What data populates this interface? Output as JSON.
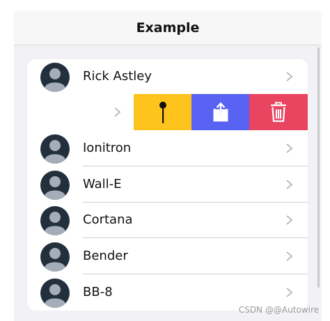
{
  "header": {
    "title": "Example"
  },
  "colors": {
    "pin": "#fec31c",
    "share": "#5862f3",
    "delete": "#ea4560",
    "avatar_bg": "#222f3c",
    "avatar_person": "#a5adb8",
    "chevron": "#b3b3b3"
  },
  "list": {
    "items": [
      {
        "label": "Rick Astley",
        "avatar_icon": "avatar-icon",
        "chevron_icon": "chevron-right-icon"
      },
      {
        "label": "Ionitron",
        "avatar_icon": "avatar-icon",
        "chevron_icon": "chevron-right-icon"
      },
      {
        "label": "Wall-E",
        "avatar_icon": "avatar-icon",
        "chevron_icon": "chevron-right-icon"
      },
      {
        "label": "Cortana",
        "avatar_icon": "avatar-icon",
        "chevron_icon": "chevron-right-icon"
      },
      {
        "label": "Bender",
        "avatar_icon": "avatar-icon",
        "chevron_icon": "chevron-right-icon"
      },
      {
        "label": "BB-8",
        "avatar_icon": "avatar-icon",
        "chevron_icon": "chevron-right-icon"
      }
    ],
    "sliding_options": [
      {
        "name": "pin",
        "icon": "pin-icon"
      },
      {
        "name": "share",
        "icon": "share-icon"
      },
      {
        "name": "delete",
        "icon": "trash-icon"
      }
    ]
  },
  "watermark": "CSDN @@Autowire"
}
